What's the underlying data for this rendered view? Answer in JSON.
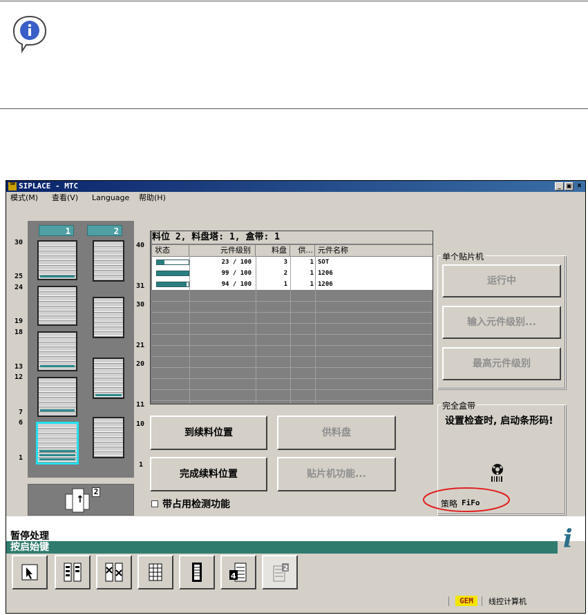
{
  "window": {
    "title": "SIPLACE - MTC",
    "min_btn": "_",
    "restore_btn": "▣",
    "close_btn": "x",
    "app_icon_text": "SW"
  },
  "menu": {
    "items": [
      "模式(M)",
      "查看(V)",
      "Language",
      "帮助(H)"
    ]
  },
  "towers": {
    "tower1_label": "1",
    "tower2_label": "2",
    "left_numbers": [
      "30",
      "25",
      "24",
      "19",
      "18",
      "13",
      "12",
      "7",
      "6",
      "1"
    ],
    "mid_numbers": [
      "40",
      "31",
      "30",
      "21",
      "20",
      "11",
      "10",
      "1"
    ],
    "step_number": "2",
    "step_arrow": "↑"
  },
  "grid": {
    "title": "料位 2, 料盘塔: 1, 盒带: 1",
    "headers": [
      "状态",
      "元件级别",
      "料盘",
      "供...",
      "元件名称"
    ],
    "rows": [
      {
        "fill": 0.23,
        "level": "23 / 100",
        "tray": "3",
        "feed": "1",
        "name": "SOT"
      },
      {
        "fill": 0.99,
        "level": "99 / 100",
        "tray": "2",
        "feed": "1",
        "name": "1206"
      },
      {
        "fill": 0.94,
        "level": "94 / 100",
        "tray": "1",
        "feed": "1",
        "name": "1206"
      }
    ]
  },
  "buttons": {
    "goto_refill": "到续料位置",
    "feeder_tray": "供料盘",
    "finish_refill": "完成续料位置",
    "placement_func": "贴片机功能...",
    "occupancy_check": "带占用检测功能"
  },
  "single_machine": {
    "label": "单个贴片机",
    "running": "运行中",
    "input_level": "输入元件级别...",
    "max_level": "最高元件级别"
  },
  "full_cassette": {
    "label": "完全盒带",
    "message": "设置检查时, 启动条形码!",
    "strategy_label": "策略",
    "strategy_value": "FiFo"
  },
  "status": {
    "line1": "暂停处理",
    "line2": "按启始键",
    "info_icon": "i"
  },
  "statusbar": {
    "gem": "GEM",
    "computer": "线控计算机"
  },
  "colors": {
    "teal": "#2a7e80",
    "highlight": "#22e0f0",
    "circle": "#e02020"
  }
}
